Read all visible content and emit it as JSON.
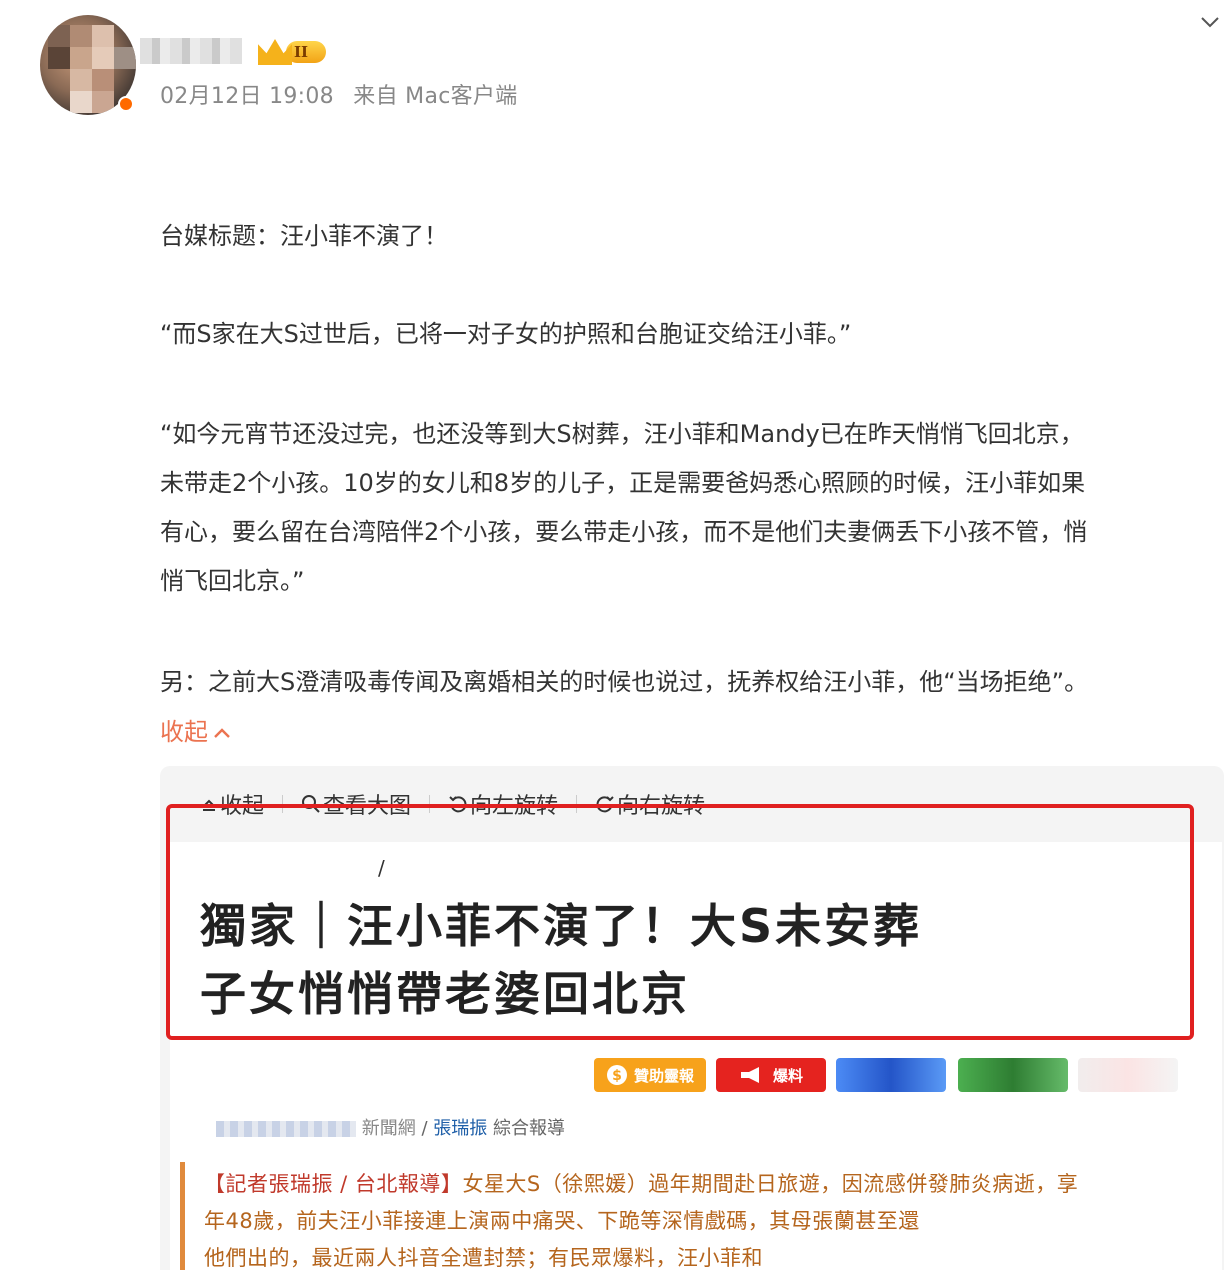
{
  "post": {
    "timestamp": "02月12日 19:08",
    "source": "来自 Mac客户端",
    "vip_level": "II",
    "paragraphs": [
      "台媒标题：汪小菲不演了！",
      "“而S家在大S过世后，已将一对子女的护照和台胞证交给汪小菲。”",
      "“如今元宵节还没过完，也还没等到大S树葬，汪小菲和Mandy已在昨天悄悄飞回北京，",
      "未带走2个小孩。10岁的女儿和8岁的儿子，正是需要爸妈悉心照顾的时候，汪小菲如果",
      "有心，要么留在台湾陪伴2个小孩，要么带走小孩，而不是他们夫妻俩丢下小孩不管，悄",
      "悄飞回北京。”",
      "另：之前大S澄清吸毒传闻及离婚相关的时候也说过，抚养权给汪小菲，他“当场拒绝”。"
    ],
    "collapse_label": "收起"
  },
  "image_toolbar": {
    "collapse": "收起",
    "view_large": "查看大图",
    "rotate_left": "向左旋转",
    "rotate_right": "向右旋转"
  },
  "article_screenshot": {
    "slash": "/",
    "headline_line1": "獨家｜汪小菲不演了！大S未安葬",
    "headline_line2": "子女悄悄帶老婆回北京",
    "buttons": {
      "support": "贊助靈報",
      "report": "爆料"
    },
    "byline_source": "新聞網",
    "byline_sep": "/",
    "byline_author": "張瑞振",
    "byline_type": "綜合報導",
    "body_tag": "【記者張瑞振 / 台北報導】",
    "body_line1": "女星大S（徐熙媛）過年期間赴日旅遊，因流感併發肺炎病逝，享",
    "body_line2": "年48歲，前夫汪小菲接連上演兩中痛哭、下跪等深情戲碼，其母張蘭甚至還",
    "body_line3": "他們出的，最近兩人抖音全遭封禁；有民眾爆料，汪小菲和"
  },
  "colors": {
    "accent": "#eb7350",
    "highlight_frame": "#e02020"
  }
}
